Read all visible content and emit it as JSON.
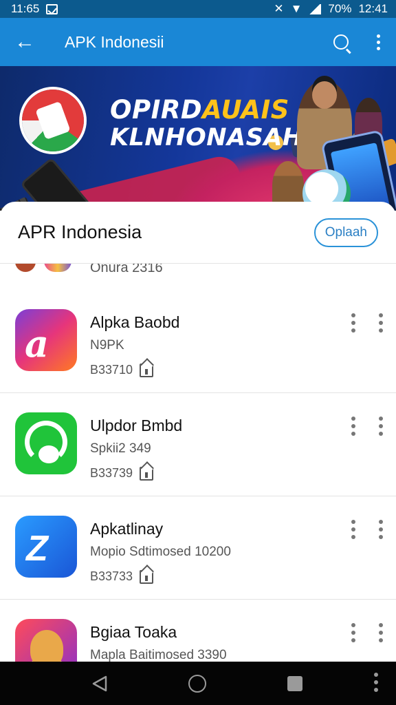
{
  "status_bar": {
    "time": "11:65",
    "battery": "70%",
    "clock": "12:41",
    "icons": [
      "notification-check-icon",
      "mute-icon",
      "wifi-icon",
      "signal-icon"
    ]
  },
  "app_bar": {
    "title": "APK Indonesii",
    "back_icon": "arrow-left-icon",
    "search_icon": "search-icon",
    "menu_icon": "more-vert-icon",
    "color": "#1a87d6"
  },
  "banner": {
    "headline_1_white": "OPIRD",
    "headline_1_yellow": "AUAIS",
    "headline_2": "KLNHONASAH"
  },
  "sheet": {
    "title": "APR Indonesia",
    "open_label": "Oplaah"
  },
  "partial_item": {
    "subtitle": "Onura 2316"
  },
  "apps": [
    {
      "name": "Alpka Baobd",
      "subtitle": "N9PK",
      "meta": "B33710",
      "icon": "app-icon-a"
    },
    {
      "name": "Ulpdor Bmbd",
      "subtitle": "Spkii2 349",
      "meta": "B33739",
      "icon": "app-icon-headset"
    },
    {
      "name": "Apkatlinay",
      "subtitle": "Mopio Sdtimosed 10200",
      "meta": "B33733",
      "icon": "app-icon-bolt"
    },
    {
      "name": "Bgiaa Toaka",
      "subtitle": "Mapla Baitimosed 3390",
      "meta": "",
      "icon": "app-icon-mascot"
    }
  ],
  "nav_bar": {
    "icons": [
      "nav-back-icon",
      "nav-home-icon",
      "nav-recents-icon",
      "nav-menu-icon"
    ]
  }
}
